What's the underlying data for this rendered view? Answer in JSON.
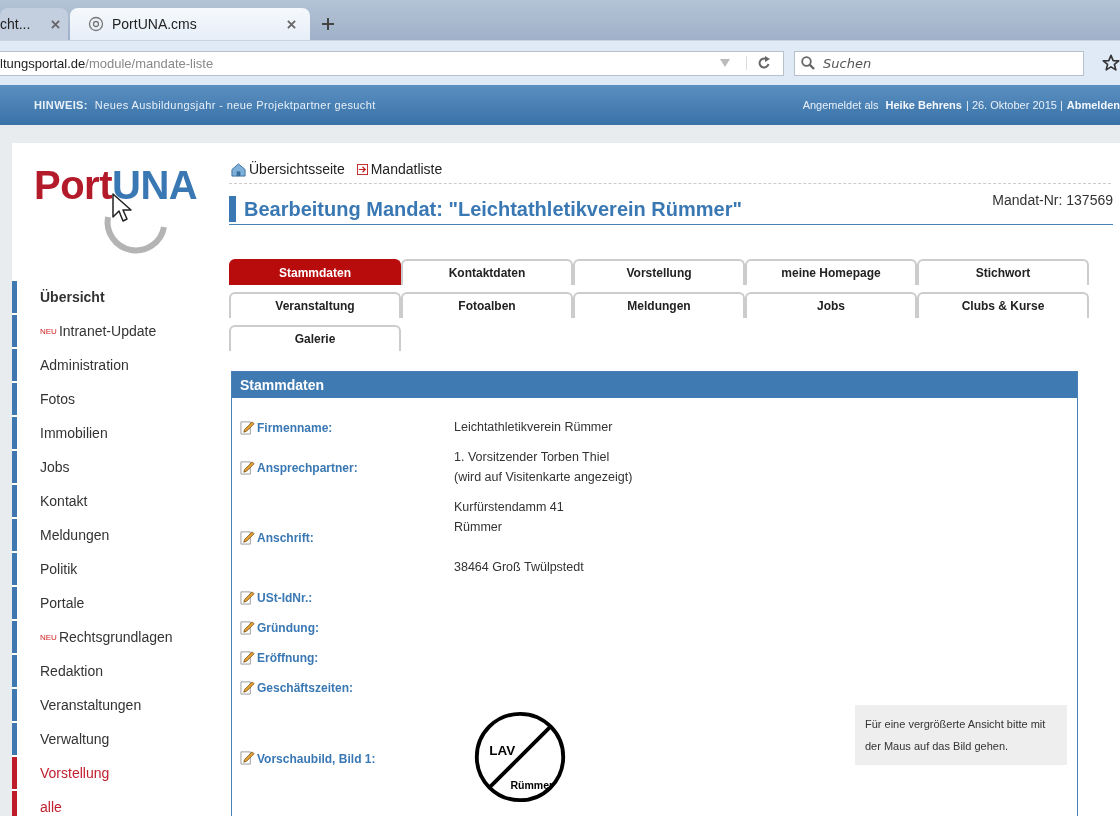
{
  "browser": {
    "tabs": [
      {
        "title": "cht...",
        "selected": false
      },
      {
        "title": "PortUNA.cms",
        "selected": true
      }
    ],
    "url": {
      "host": "ltungsportal.de",
      "path": "/module/mandate-liste"
    },
    "search": {
      "placeholder": "Suchen"
    }
  },
  "notice": {
    "label": "HINWEIS:",
    "text": "Neues Ausbildungsjahr - neue Projektpartner gesucht"
  },
  "user_info": {
    "prefix": "Angemeldet als",
    "name": "Heike Behrens",
    "date": "| 26. Oktober 2015 |",
    "logout": "Abmelden"
  },
  "logo": {
    "part_1": "Port",
    "part_2": "UNA"
  },
  "sidebar": {
    "items": [
      {
        "label": "Übersicht",
        "bold": true,
        "selected": false
      },
      {
        "label": "Intranet-Update",
        "badge": "NEU",
        "selected": false
      },
      {
        "label": "Administration",
        "selected": false
      },
      {
        "label": "Fotos",
        "selected": false
      },
      {
        "label": "Immobilien",
        "selected": false
      },
      {
        "label": "Jobs",
        "selected": false
      },
      {
        "label": "Kontakt",
        "selected": false
      },
      {
        "label": "Meldungen",
        "selected": false
      },
      {
        "label": "Politik",
        "selected": false
      },
      {
        "label": "Portale",
        "selected": false
      },
      {
        "label": "Rechtsgrundlagen",
        "badge": "NEU",
        "selected": false
      },
      {
        "label": "Redaktion",
        "selected": false
      },
      {
        "label": "Veranstaltungen",
        "selected": false
      },
      {
        "label": "Verwaltung",
        "selected": false
      },
      {
        "label": "Vorstellung",
        "selected": true
      },
      {
        "label": "alle",
        "selected": true
      }
    ]
  },
  "breadcrumb": [
    {
      "kind": "home",
      "label": "Übersichtsseite"
    },
    {
      "kind": "list",
      "label": "Mandatliste"
    }
  ],
  "heading": "Bearbeitung Mandat: \"Leichtathletikverein Rümmer\"",
  "mandate_number": "Mandat-Nr: 137569",
  "tabs": [
    {
      "label": "Stammdaten",
      "selected": true
    },
    {
      "label": "Kontaktdaten",
      "selected": false
    },
    {
      "label": "Vorstellung",
      "selected": false
    },
    {
      "label": "meine Homepage",
      "selected": false
    },
    {
      "label": "Stichwort",
      "selected": false
    },
    {
      "label": "Veranstaltung",
      "selected": false
    },
    {
      "label": "Fotoalben",
      "selected": false
    },
    {
      "label": "Meldungen",
      "selected": false
    },
    {
      "label": "Jobs",
      "selected": false
    },
    {
      "label": "Clubs & Kurse",
      "selected": false
    },
    {
      "label": "Galerie",
      "selected": false
    }
  ],
  "panel": {
    "title": "Stammdaten",
    "fields": [
      {
        "label": "Firmenname:",
        "value": [
          [
            "Leichtathletikverein Rümmer"
          ]
        ]
      },
      {
        "label": "Ansprechpartner:",
        "value": [
          [
            "1. Vorsitzender Torben Thiel",
            "(wird auf Visitenkarte angezeigt)"
          ]
        ]
      },
      {
        "label": "Anschrift:",
        "value": [
          [
            "Kurfürstendamm 41",
            "Rümmer"
          ],
          [
            "38464 Groß Twülpstedt"
          ]
        ]
      },
      {
        "label": "USt-IdNr.:"
      },
      {
        "label": "Gründung:"
      },
      {
        "label": "Eröffnung:"
      },
      {
        "label": "Geschäftszeiten:"
      },
      {
        "label": "Vorschaubild, Bild 1:",
        "image": {
          "top": "LAV",
          "bottom": "Rümmer"
        },
        "hint": "Für eine vergrößerte Ansicht bitte mit der Maus auf das Bild gehen."
      }
    ]
  }
}
